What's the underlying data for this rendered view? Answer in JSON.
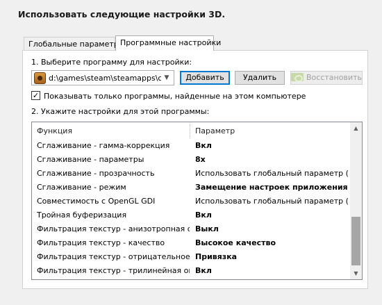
{
  "heading": "Использовать следующие настройки 3D.",
  "tabs": [
    {
      "label": "Глобальные параметры",
      "active": false
    },
    {
      "label": "Программные настройки",
      "active": true
    }
  ],
  "step1": {
    "label": "1. Выберите программу для настройки:",
    "program_value": "d:\\games\\steam\\steamapps\\co...",
    "program_icon": "game-icon",
    "add_label": "Добавить",
    "remove_label": "Удалить",
    "restore_label": "Восстановить",
    "restore_icon": "nvidia-icon"
  },
  "checkbox": {
    "label": "Показывать только программы, найденные на этом компьютере",
    "checked": true
  },
  "step2": {
    "label": "2. Укажите настройки для этой программы:"
  },
  "settings_table": {
    "columns": [
      "Функция",
      "Параметр"
    ],
    "rows": [
      {
        "feature": "Сглаживание - гамма-коррекция",
        "value": "Вкл",
        "bold": true
      },
      {
        "feature": "Сглаживание - параметры",
        "value": "8x",
        "bold": true
      },
      {
        "feature": "Сглаживание - прозрачность",
        "value": "Использовать глобальный параметр (В...",
        "bold": false
      },
      {
        "feature": "Сглаживание - режим",
        "value": "Замещение настроек приложения",
        "bold": true
      },
      {
        "feature": "Совместимость с OpenGL GDI",
        "value": "Использовать глобальный параметр (А...",
        "bold": false
      },
      {
        "feature": "Тройная буферизация",
        "value": "Вкл",
        "bold": true
      },
      {
        "feature": "Фильтрация текстур - анизотропная оп...",
        "value": "Выкл",
        "bold": true
      },
      {
        "feature": "Фильтрация текстур - качество",
        "value": "Высокое качество",
        "bold": true
      },
      {
        "feature": "Фильтрация текстур - отрицательное о...",
        "value": "Привязка",
        "bold": true
      },
      {
        "feature": "Фильтрация текстур - трилинейная опт...",
        "value": "Вкл",
        "bold": true
      }
    ]
  }
}
